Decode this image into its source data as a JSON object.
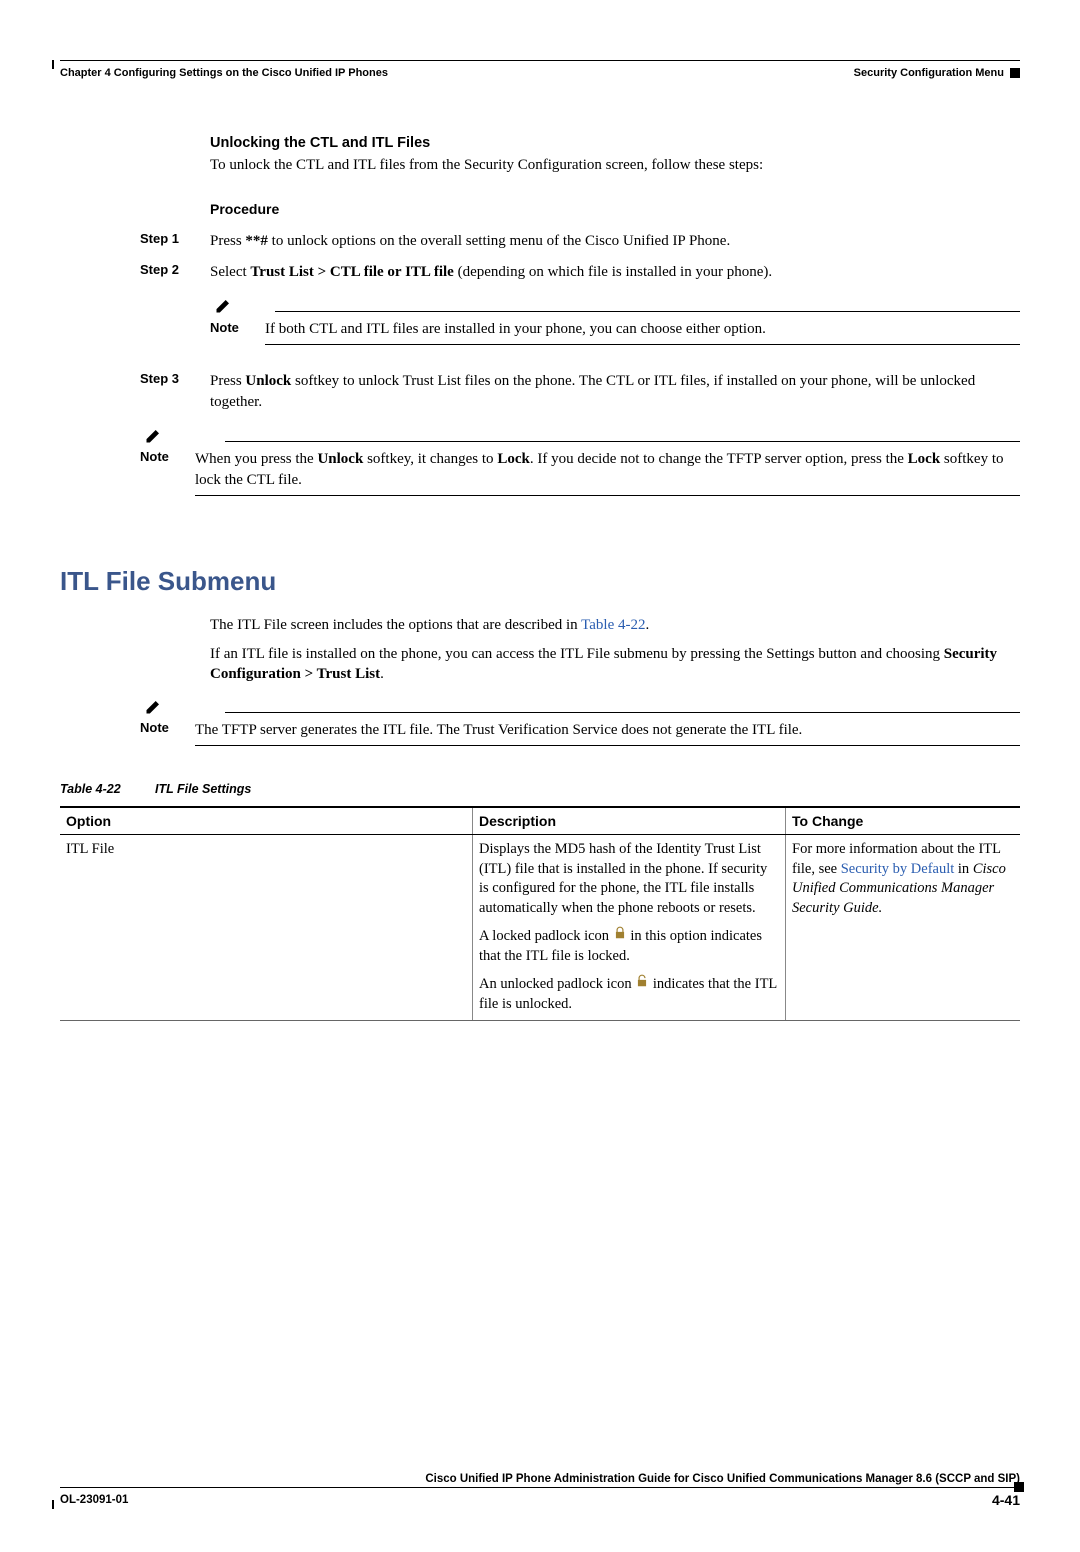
{
  "header": {
    "chapter": "Chapter 4      Configuring Settings on the Cisco Unified IP Phones",
    "section": "Security Configuration Menu"
  },
  "section1": {
    "heading": "Unlocking the CTL and ITL Files",
    "intro": "To unlock the CTL and ITL files from the Security Configuration screen, follow these steps:",
    "procedure_label": "Procedure",
    "steps": [
      {
        "label": "Step 1",
        "pre": "Press ",
        "bold1": "**#",
        "post": " to unlock options on the overall setting menu of the Cisco Unified IP Phone."
      },
      {
        "label": "Step 2",
        "pre": "Select ",
        "bold1": "Trust List > CTL file or ITL file",
        "post": " (depending on which file is installed in your phone)."
      },
      {
        "label": "Step 3",
        "pre": "Press ",
        "bold1": "Unlock",
        "post": " softkey to unlock Trust List files on the phone. The CTL or ITL files, if installed on your phone, will be unlocked together."
      }
    ],
    "note_inner": {
      "label": "Note",
      "text": "If both CTL and ITL files are installed in your phone, you can choose either option."
    },
    "note_outer": {
      "label": "Note",
      "pre": "When you press the ",
      "b1": "Unlock",
      "mid1": " softkey, it changes to ",
      "b2": "Lock",
      "mid2": ". If you decide not to change the TFTP server option, press the ",
      "b3": "Lock",
      "post": " softkey to lock the CTL file."
    }
  },
  "section2": {
    "heading": "ITL File Submenu",
    "p1_pre": "The ITL File screen includes the options that are described in ",
    "p1_link": "Table 4-22",
    "p1_post": ".",
    "p2_pre": "If an ITL file is installed on the phone, you can access the ITL File submenu by pressing the Settings button and choosing ",
    "p2_bold": "Security Configuration > Trust List",
    "p2_post": ".",
    "note": {
      "label": "Note",
      "text": "The TFTP server generates the ITL file. The Trust Verification Service does not generate the ITL file."
    },
    "table": {
      "caption_num": "Table 4-22",
      "caption_title": "ITL File Settings",
      "headers": [
        "Option",
        "Description",
        "To Change"
      ],
      "row": {
        "option": "ITL File",
        "desc_p1": "Displays the MD5 hash of the Identity Trust List (ITL) file that is installed in the phone. If security is configured for the phone, the ITL file installs automatically when the phone reboots or resets.",
        "desc_p2_pre": "A locked padlock icon ",
        "desc_p2_post": " in this option indicates that the ITL file is locked.",
        "desc_p3_pre": "An unlocked padlock icon ",
        "desc_p3_post": " indicates that the ITL file is unlocked.",
        "change_pre": "For more information about the ITL file, see ",
        "change_link": "Security by Default",
        "change_mid": " in ",
        "change_italic": "Cisco Unified Communications Manager Security Guide."
      }
    }
  },
  "footer": {
    "book": "Cisco Unified IP Phone Administration Guide for Cisco Unified Communications Manager 8.6 (SCCP and SIP)",
    "docid": "OL-23091-01",
    "page": "4-41"
  }
}
